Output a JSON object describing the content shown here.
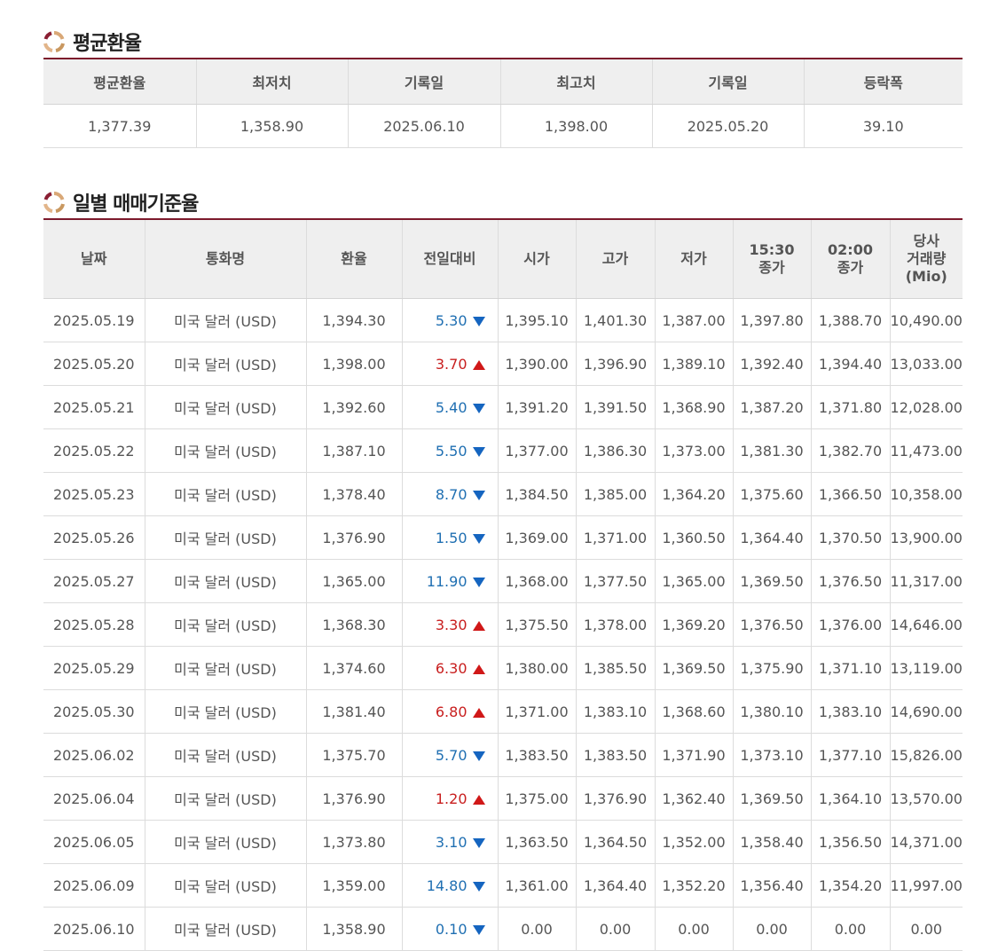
{
  "colors": {
    "accent": "#7d1a2c",
    "down": "#1f6fb2",
    "up": "#c81e1e"
  },
  "average_section": {
    "title": "평균환율",
    "headers": [
      "평균환율",
      "최저치",
      "기록일",
      "최고치",
      "기록일",
      "등락폭"
    ],
    "values": [
      "1,377.39",
      "1,358.90",
      "2025.06.10",
      "1,398.00",
      "2025.05.20",
      "39.10"
    ]
  },
  "daily_section": {
    "title": "일별 매매기준율",
    "headers": [
      [
        "날짜"
      ],
      [
        "통화명"
      ],
      [
        "환율"
      ],
      [
        "전일대비"
      ],
      [
        "시가"
      ],
      [
        "고가"
      ],
      [
        "저가"
      ],
      [
        "15:30",
        "종가"
      ],
      [
        "02:00",
        "종가"
      ],
      [
        "당사",
        "거래량",
        "(Mio)"
      ]
    ],
    "rows": [
      {
        "date": "2025.05.19",
        "currency": "미국 달러 (USD)",
        "rate": "1,394.30",
        "change": "5.30",
        "direction": "down",
        "open": "1,395.10",
        "high": "1,401.30",
        "low": "1,387.00",
        "close1530": "1,397.80",
        "close0200": "1,388.70",
        "volume": "10,490.00"
      },
      {
        "date": "2025.05.20",
        "currency": "미국 달러 (USD)",
        "rate": "1,398.00",
        "change": "3.70",
        "direction": "up",
        "open": "1,390.00",
        "high": "1,396.90",
        "low": "1,389.10",
        "close1530": "1,392.40",
        "close0200": "1,394.40",
        "volume": "13,033.00"
      },
      {
        "date": "2025.05.21",
        "currency": "미국 달러 (USD)",
        "rate": "1,392.60",
        "change": "5.40",
        "direction": "down",
        "open": "1,391.20",
        "high": "1,391.50",
        "low": "1,368.90",
        "close1530": "1,387.20",
        "close0200": "1,371.80",
        "volume": "12,028.00"
      },
      {
        "date": "2025.05.22",
        "currency": "미국 달러 (USD)",
        "rate": "1,387.10",
        "change": "5.50",
        "direction": "down",
        "open": "1,377.00",
        "high": "1,386.30",
        "low": "1,373.00",
        "close1530": "1,381.30",
        "close0200": "1,382.70",
        "volume": "11,473.00"
      },
      {
        "date": "2025.05.23",
        "currency": "미국 달러 (USD)",
        "rate": "1,378.40",
        "change": "8.70",
        "direction": "down",
        "open": "1,384.50",
        "high": "1,385.00",
        "low": "1,364.20",
        "close1530": "1,375.60",
        "close0200": "1,366.50",
        "volume": "10,358.00"
      },
      {
        "date": "2025.05.26",
        "currency": "미국 달러 (USD)",
        "rate": "1,376.90",
        "change": "1.50",
        "direction": "down",
        "open": "1,369.00",
        "high": "1,371.00",
        "low": "1,360.50",
        "close1530": "1,364.40",
        "close0200": "1,370.50",
        "volume": "13,900.00"
      },
      {
        "date": "2025.05.27",
        "currency": "미국 달러 (USD)",
        "rate": "1,365.00",
        "change": "11.90",
        "direction": "down",
        "open": "1,368.00",
        "high": "1,377.50",
        "low": "1,365.00",
        "close1530": "1,369.50",
        "close0200": "1,376.50",
        "volume": "11,317.00"
      },
      {
        "date": "2025.05.28",
        "currency": "미국 달러 (USD)",
        "rate": "1,368.30",
        "change": "3.30",
        "direction": "up",
        "open": "1,375.50",
        "high": "1,378.00",
        "low": "1,369.20",
        "close1530": "1,376.50",
        "close0200": "1,376.00",
        "volume": "14,646.00"
      },
      {
        "date": "2025.05.29",
        "currency": "미국 달러 (USD)",
        "rate": "1,374.60",
        "change": "6.30",
        "direction": "up",
        "open": "1,380.00",
        "high": "1,385.50",
        "low": "1,369.50",
        "close1530": "1,375.90",
        "close0200": "1,371.10",
        "volume": "13,119.00"
      },
      {
        "date": "2025.05.30",
        "currency": "미국 달러 (USD)",
        "rate": "1,381.40",
        "change": "6.80",
        "direction": "up",
        "open": "1,371.00",
        "high": "1,383.10",
        "low": "1,368.60",
        "close1530": "1,380.10",
        "close0200": "1,383.10",
        "volume": "14,690.00"
      },
      {
        "date": "2025.06.02",
        "currency": "미국 달러 (USD)",
        "rate": "1,375.70",
        "change": "5.70",
        "direction": "down",
        "open": "1,383.50",
        "high": "1,383.50",
        "low": "1,371.90",
        "close1530": "1,373.10",
        "close0200": "1,377.10",
        "volume": "15,826.00"
      },
      {
        "date": "2025.06.04",
        "currency": "미국 달러 (USD)",
        "rate": "1,376.90",
        "change": "1.20",
        "direction": "up",
        "open": "1,375.00",
        "high": "1,376.90",
        "low": "1,362.40",
        "close1530": "1,369.50",
        "close0200": "1,364.10",
        "volume": "13,570.00"
      },
      {
        "date": "2025.06.05",
        "currency": "미국 달러 (USD)",
        "rate": "1,373.80",
        "change": "3.10",
        "direction": "down",
        "open": "1,363.50",
        "high": "1,364.50",
        "low": "1,352.00",
        "close1530": "1,358.40",
        "close0200": "1,356.50",
        "volume": "14,371.00"
      },
      {
        "date": "2025.06.09",
        "currency": "미국 달러 (USD)",
        "rate": "1,359.00",
        "change": "14.80",
        "direction": "down",
        "open": "1,361.00",
        "high": "1,364.40",
        "low": "1,352.20",
        "close1530": "1,356.40",
        "close0200": "1,354.20",
        "volume": "11,997.00"
      },
      {
        "date": "2025.06.10",
        "currency": "미국 달러 (USD)",
        "rate": "1,358.90",
        "change": "0.10",
        "direction": "down",
        "open": "0.00",
        "high": "0.00",
        "low": "0.00",
        "close1530": "0.00",
        "close0200": "0.00",
        "volume": "0.00"
      }
    ]
  }
}
